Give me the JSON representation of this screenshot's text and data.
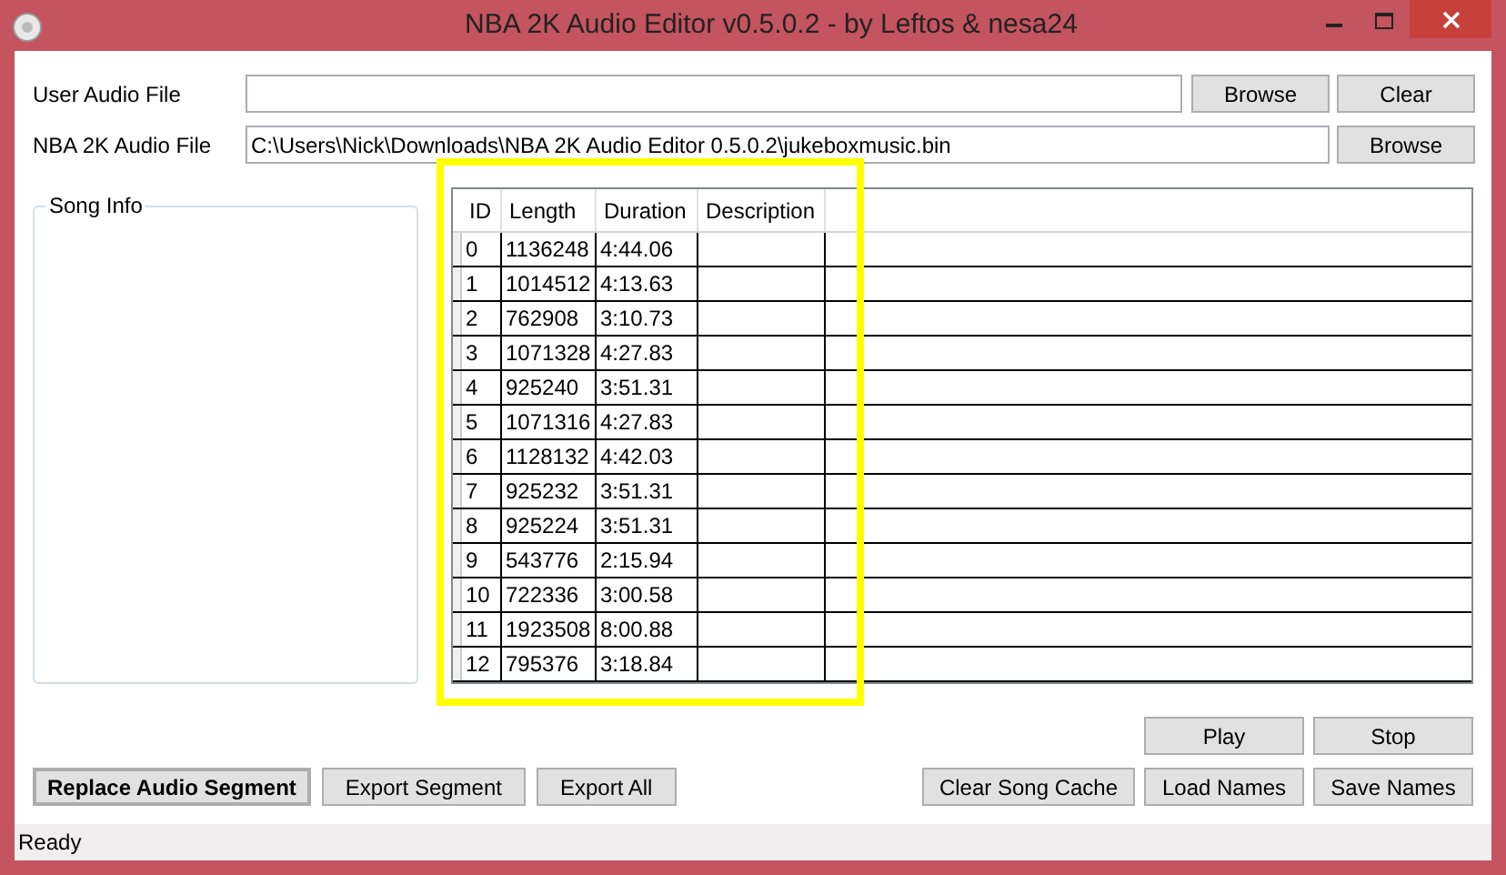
{
  "window": {
    "title": "NBA 2K Audio Editor v0.5.0.2 - by Leftos & nesa24"
  },
  "user_audio_file": {
    "label": "User Audio File",
    "browse": "Browse",
    "clear": "Clear"
  },
  "nba_audio_file": {
    "label": "NBA 2K Audio File",
    "value": "C:\\Users\\Nick\\Downloads\\NBA 2K Audio Editor 0.5.0.2\\jukeboxmusic.bin",
    "browse": "Browse"
  },
  "song_info": {
    "title": "Song Info"
  },
  "table": {
    "columns": [
      "ID",
      "Length",
      "Duration",
      "Description"
    ],
    "rows": [
      [
        "0",
        "1136248",
        "4:44.06"
      ],
      [
        "1",
        "1014512",
        "4:13.63"
      ],
      [
        "2",
        "762908",
        "3:10.73"
      ],
      [
        "3",
        "1071328",
        "4:27.83"
      ],
      [
        "4",
        "925240",
        "3:51.31"
      ],
      [
        "5",
        "1071316",
        "4:27.83"
      ],
      [
        "6",
        "1128132",
        "4:42.03"
      ],
      [
        "7",
        "925232",
        "3:51.31"
      ],
      [
        "8",
        "925224",
        "3:51.31"
      ],
      [
        "9",
        "543776",
        "2:15.94"
      ],
      [
        "10",
        "722336",
        "3:00.58"
      ],
      [
        "11",
        "1923508",
        "8:00.88"
      ],
      [
        "12",
        "795376",
        "3:18.84"
      ]
    ]
  },
  "playback_buttons": [
    "Play",
    "Stop"
  ],
  "left_buttons": [
    {
      "label": "Replace Audio Segment",
      "default": true
    },
    {
      "label": "Export Segment",
      "default": false
    },
    {
      "label": "Export All",
      "default": false
    }
  ],
  "right_buttons": [
    "Clear Song Cache",
    "Load Names",
    "Save Names"
  ],
  "status_bar": "Ready"
}
